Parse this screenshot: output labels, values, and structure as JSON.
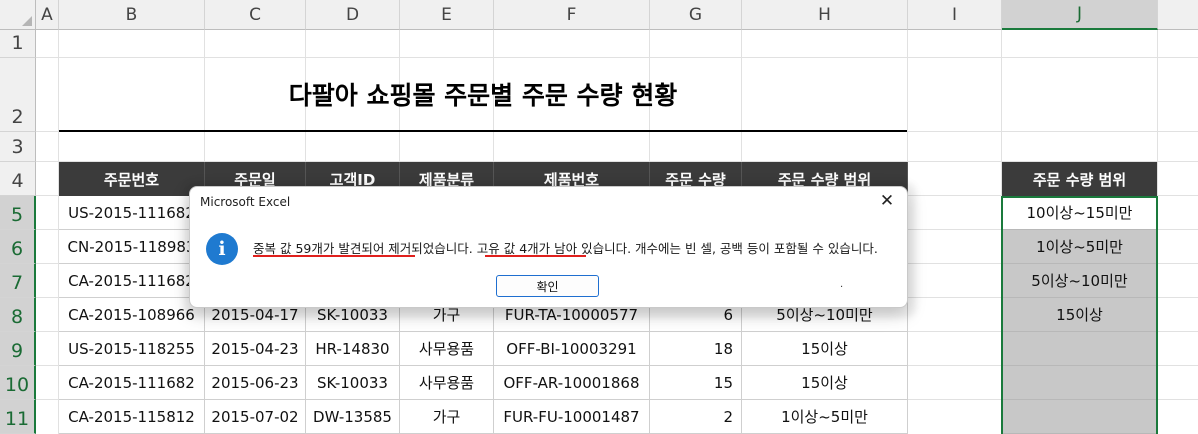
{
  "columns": [
    "A",
    "B",
    "C",
    "D",
    "E",
    "F",
    "G",
    "H",
    "I",
    "J"
  ],
  "rows": [
    "1",
    "2",
    "3",
    "4",
    "5",
    "6",
    "7",
    "8",
    "9",
    "10",
    "11"
  ],
  "title": "다팔아 쇼핑몰 주문별 주문 수량 현황",
  "table": {
    "headers": [
      "주문번호",
      "주문일",
      "고객ID",
      "제품분류",
      "제품번호",
      "주문 수량",
      "주문 수량 범위"
    ],
    "rows": [
      [
        "US-2015-111682",
        "",
        "",
        "",
        "",
        "",
        ""
      ],
      [
        "CN-2015-118983",
        "",
        "",
        "",
        "",
        "",
        ""
      ],
      [
        "CA-2015-111682",
        "",
        "",
        "",
        "",
        "",
        ""
      ],
      [
        "CA-2015-108966",
        "2015-04-17",
        "SK-10033",
        "가구",
        "FUR-TA-10000577",
        "6",
        "5이상~10미만"
      ],
      [
        "US-2015-118255",
        "2015-04-23",
        "HR-14830",
        "사무용품",
        "OFF-BI-10003291",
        "18",
        "15이상"
      ],
      [
        "CA-2015-111682",
        "2015-06-23",
        "SK-10033",
        "사무용품",
        "OFF-AR-10001868",
        "15",
        "15이상"
      ],
      [
        "CA-2015-115812",
        "2015-07-02",
        "DW-13585",
        "가구",
        "FUR-FU-10001487",
        "2",
        "1이상~5미만"
      ]
    ]
  },
  "side": {
    "header": "주문 수량 범위",
    "values": [
      "10이상~15미만",
      "1이상~5미만",
      "5이상~10미만",
      "15이상",
      "",
      "",
      ""
    ]
  },
  "dialog": {
    "title": "Microsoft Excel",
    "close_label": "✕",
    "icon_label": "i",
    "message": "중복 값 59개가 발견되어 제거되었습니다. 고유 값 4개가 남아 있습니다. 개수에는 빈 셀, 공백 등이 포함될 수 있습니다.",
    "ok_label": "확인",
    "dot": "."
  },
  "colors": {
    "header_bg": "#3b3b3b",
    "selection": "#1a7a3c",
    "side_fill": "#c8c8c8",
    "info": "#1f7ad0",
    "underline": "#e0201d"
  }
}
